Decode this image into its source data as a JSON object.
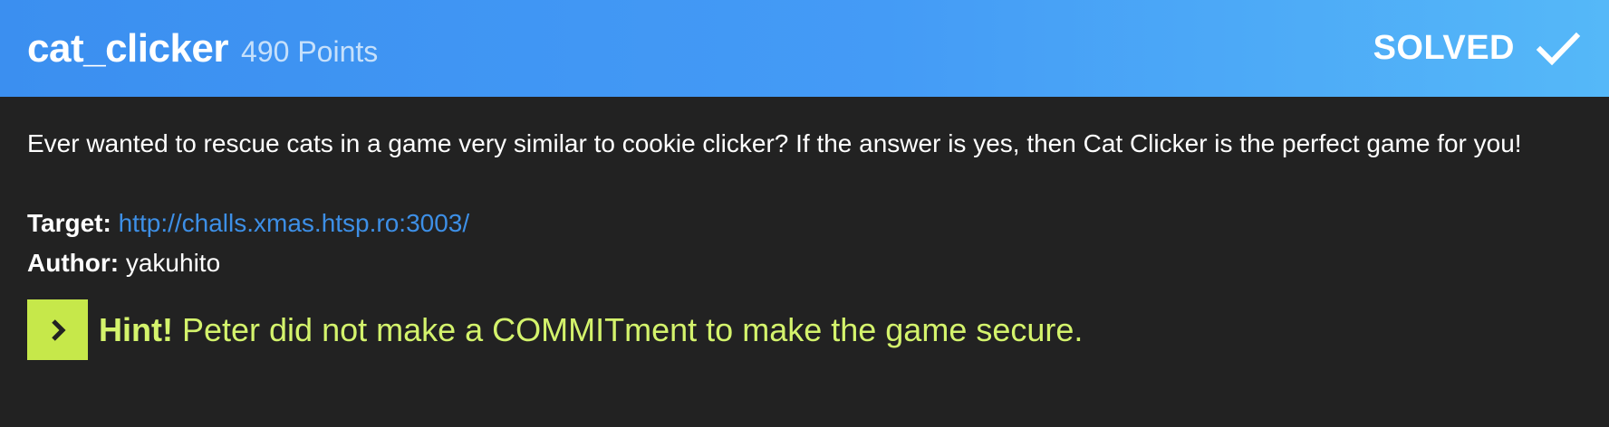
{
  "challenge": {
    "title": "cat_clicker",
    "points": "490 Points",
    "status": "SOLVED",
    "status_icon": "check-icon",
    "description": "Ever wanted to rescue cats in a game very similar to cookie clicker? If the answer is yes, then Cat Clicker is the perfect game for you!",
    "target_label": "Target:",
    "target_url": "http://challs.xmas.htsp.ro:3003/",
    "author_label": "Author:",
    "author": "yakuhito",
    "hint_label": "Hint!",
    "hint_text": "Peter did not make a COMMITment to make the game secure."
  },
  "colors": {
    "header_start": "#3b8ff0",
    "header_end": "#55b8f8",
    "background": "#222222",
    "link": "#3d8fe6",
    "hint_accent": "#c6e84a",
    "hint_text": "#d4f36c"
  }
}
